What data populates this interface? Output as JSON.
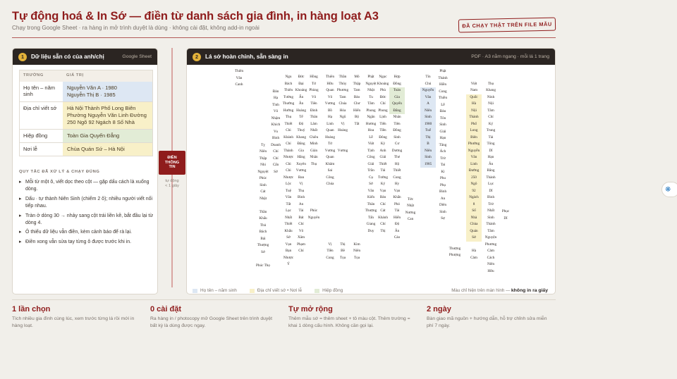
{
  "header": {
    "title": "Tự động hoá & In Sớ — điền từ danh sách gia đình, in hàng loạt A3",
    "subtitle": "Chạy trong Google Sheet · ra hàng in mở trình duyệt là dùng · không cài đặt, không add-in ngoài",
    "stamp": "ĐÃ CHẠY THẬT TRÊN FILE MẪU"
  },
  "left_panel": {
    "num": "1",
    "title": "Dữ liệu sẵn có của anh/chị",
    "tag": "Google Sheet",
    "table": {
      "headers": [
        "TRƯỜNG",
        "GIÁ TRỊ"
      ],
      "rows": [
        {
          "field": "Họ tên – năm sinh",
          "value": "Nguyễn Văn A · 1980\nNguyễn Thị B · 1985",
          "color": "#dde7f3"
        },
        {
          "field": "Địa chỉ viết sớ",
          "value": "Hà Nội Thành Phố Long Biên Phường Nguyễn Văn Linh Đường 250 Ngõ 92 Ngách 8 Số Nhà",
          "color": "#f8f0c8"
        },
        {
          "field": "Hiệp đồng",
          "value": "Toàn Gia Quyến Đẳng",
          "color": "#e2ecd6"
        },
        {
          "field": "Nơi lễ",
          "value": "Chùa Quán Sứ – Hà Nội",
          "color": "#f8f0c8"
        }
      ]
    },
    "rules_title": "QUY TẮC ĐÃ XỬ LÝ & CHẠY ĐÚNG",
    "rules": [
      "Mỗi từ một ô, viết dọc theo cột — gặp dấu cách là xuống dòng.",
      "Dấu · tự thành Niên Sinh (chiếm 2 ô); nhiều người viết nối tiếp nhau.",
      "Tràn ở dòng 30 → nhảy sang cột trái liền kề, bắt đầu lại từ dòng 4.",
      "Ô thiếu dữ liệu vẫn điền, kèm cảnh báo để rà lại.",
      "Điền xong vẫn sửa tay từng ô được trước khi in."
    ]
  },
  "middle": {
    "label": "ĐIỀN\nTHÔNG\nTIN",
    "note": "tự động\n< 1 giây"
  },
  "right_panel": {
    "num": "2",
    "title": "Lá sớ hoàn chỉnh, sẵn sàng in",
    "tag": "PDF · A3 nằm ngang · mỗi lá 1 trang",
    "columns": [
      [
        "Thiên",
        "Văn",
        "Canh"
      ],
      [
        "",
        "",
        "",
        "",
        "",
        "",
        "",
        "",
        "",
        "",
        "",
        "Tỵ",
        "Niên",
        "Thập",
        "Nhi",
        "Nguyệt",
        "Phúc",
        "Sinh",
        "Cát",
        "Nhật",
        "",
        "Thần",
        "Khấu",
        "Thủ",
        "Bách",
        "Bái",
        "Thượng",
        "Sớ",
        "",
        "Phúc Thọ"
      ],
      [
        "",
        "",
        "",
        "Đàn",
        "Hạ",
        "Tình",
        "Vô",
        "Nhậm",
        "Khích",
        "Vu",
        "Bình",
        "Doanh",
        "Chí",
        "Chí",
        "Cẩn",
        "Sớ"
      ],
      [
        "Ngu",
        "Bách",
        "Thiên",
        "Tường",
        "Thường",
        "Hưởng",
        "Thụ",
        "Thiết",
        "Chi",
        "Khánh",
        "Chí",
        "Thành",
        "Nhược",
        "Chi",
        "Chi",
        "Nhược",
        "Lộc",
        "Tuệ",
        "Văn",
        "Tất",
        "Lạc",
        "Nhất",
        "Thiết",
        "Khẩu",
        "Sớ",
        "Vạn",
        "Bạn",
        "Nhược",
        "Ý"
      ],
      [
        "Đức",
        "Đại",
        "Khoáng",
        "Ẩn",
        "Ân",
        "Hoàng",
        "Tế",
        "Độ",
        "Thuỷ",
        "Khang",
        "Đăng",
        "Gia",
        "Hằng",
        "Xuyên",
        "Vương",
        "Ban",
        "Vị",
        "Thụ",
        "Bình",
        "An",
        "Tài",
        "Bát",
        "Chí",
        "Vô",
        "Xâm",
        "Phạm",
        "Chí"
      ],
      [
        "Hồng",
        "Tứ",
        "Phùng",
        "Vô",
        "Tiên",
        "Đình",
        "Thân",
        "Lâm",
        "Nhất",
        "Chiêu",
        "Minh",
        "Gián",
        "Nhân",
        "Thụ",
        "",
        "",
        "",
        "",
        "",
        "",
        "Phúc",
        "Nguyên"
      ],
      [
        "Thiên",
        "Hữu",
        "Quan",
        "Vô",
        "Vương",
        "Bồ",
        "Hạ",
        "Linh",
        "Quan",
        "Hoàng",
        "Tứ",
        "Vương",
        "Quan",
        "Khâm",
        "Sai",
        "Công",
        "Chúa",
        "",
        "",
        "",
        "",
        "",
        "",
        "",
        "",
        "Vị",
        "Tiền",
        "Cung"
      ],
      [
        "Thần",
        "Thủy",
        "Phương",
        "Tam",
        "Chúa",
        "Hóa",
        "Ngũ",
        "Vị",
        "Hoàng",
        "",
        "",
        "Vương",
        "",
        "",
        "",
        "",
        "",
        "",
        "",
        "",
        "",
        "",
        "",
        "",
        "",
        "Thị",
        "Bề",
        "Tọa"
      ],
      [
        "Mô",
        "Thập",
        "Tam",
        "Bảo",
        "Chư",
        "Hiển",
        "Bộ",
        "Tất",
        "",
        "",
        "",
        "",
        "",
        "",
        "",
        "",
        "",
        "",
        "",
        "",
        "",
        "",
        "",
        "",
        "",
        "Kim",
        "Niên",
        "Tọa"
      ],
      [
        "Phật",
        "Nguyệt",
        "Nhật",
        "Tu",
        "Tâm",
        "Phong",
        "Ngân",
        "Hương",
        "Hoa",
        "Lễ",
        "Việt",
        "Tịnh",
        "Công",
        "Giải",
        "Trần",
        "Cụ",
        "Sở",
        "Văn",
        "Kiến",
        "Thân",
        "Thượng",
        "Tấn",
        "Giang",
        "Duy"
      ],
      [
        "Ngọc",
        "Khoáng",
        "Phù",
        "Đức",
        "Chí",
        "Phong",
        "Lịnh",
        "Tiến",
        "Tiền",
        "Đông",
        "Kỳ",
        "Anh",
        "Giải",
        "Thiết",
        "Tải",
        "Tường",
        "Kỷ",
        "Vạn",
        "Bản",
        "Chí",
        "Cát",
        "Khánh",
        "Chí",
        "Thị"
      ],
      [
        "Hợp",
        "Đồng",
        "Toàn",
        "Gia",
        "Quyến",
        "Đẳng",
        "Nhân",
        "Tiên",
        "Đồng",
        "Sinh",
        "Cư",
        "Dương",
        "Thé",
        "Hộ",
        "Thiết",
        "Cung",
        "Hy",
        "Vạn",
        "Khẩn",
        "Phó",
        "Tài",
        "Hiển",
        "Độ",
        "Ân",
        "Cáo"
      ],
      [
        "",
        "",
        "",
        "",
        "",
        "",
        "",
        "",
        "",
        "Tức",
        "Nhật",
        "Nương",
        "Can"
      ],
      [
        "Tín",
        "Chủ",
        "Nguyễn",
        "Văn",
        "A",
        "Niên",
        "Sinh",
        "1980",
        "Tuế",
        "Thị",
        "B",
        "Niên",
        "Sinh",
        "1985"
      ],
      [
        "Phật",
        "Thánh",
        "Hiền",
        "Cung",
        "Thiền",
        "Lễ",
        "Đàu",
        "Tôn",
        "Sinh",
        "Giải",
        "Hạn",
        "Tăng",
        "Ách",
        "Trừ",
        "Tai",
        "Kì",
        "Phu",
        "Phụ",
        "Bình",
        "An",
        "Diên",
        "Sinh",
        "Sự"
      ],
      [
        "",
        "",
        "",
        "",
        "",
        "",
        "",
        "",
        "",
        "",
        "",
        "",
        "",
        "Thượng",
        "Phượng"
      ],
      [
        "",
        "Việt",
        "Nam",
        "Quốc",
        "Hà",
        "Nội",
        "Thành",
        "Phố",
        "Long",
        "Biên",
        "Phường",
        "Nguyễn",
        "Văn",
        "Linh",
        "Đường",
        "250",
        "Ngõ",
        "92",
        "Ngách",
        "8",
        "Số",
        "Nhà",
        "Chùa",
        "Quán",
        "Sứ",
        "",
        "Hà",
        "Cảm"
      ],
      [
        "",
        "Thọ",
        "Khang",
        "Ninh",
        "Nội",
        "Tâm",
        "Chí",
        "Ký",
        "Trung",
        "Tài",
        "Tông",
        "Dĩ",
        "Hạn",
        "Ân",
        "Bằng",
        "Thành",
        "Lục",
        "Dĩ",
        "Bình",
        "Trừ",
        "Nhất",
        "Sinh",
        "Thành",
        "Tâm",
        "Nguyện",
        "Phương",
        "Cảm",
        "Cách",
        "Niên",
        "Hữu"
      ],
      [
        "",
        "",
        "",
        "",
        "",
        "",
        "",
        "",
        "",
        "",
        "Phục",
        "Dĩ"
      ]
    ],
    "legend": [
      {
        "label": "Họ tên – năm sinh",
        "color": "#dde7f3"
      },
      {
        "label": "Địa chỉ viết sớ • Nơi lễ",
        "color": "#f8f0c8"
      },
      {
        "label": "Hiệp đồng",
        "color": "#e2ecd6"
      }
    ],
    "legend_note": "Màu chỉ hiện trên màn hình —",
    "legend_note_bold": "không in ra giấy"
  },
  "features": [
    {
      "title": "1 lần chọn",
      "desc": "Tích nhiều gia đình cùng lúc, xem trước từng lá rồi mới in hàng loạt."
    },
    {
      "title": "0 cài đặt",
      "desc": "Ra hàng in / photocopy mở Google Sheet trên trình duyệt bất kỳ là dùng được ngay."
    },
    {
      "title": "Tự mở rộng",
      "desc": "Thêm mẫu sớ = thêm sheet + tô màu cột. Thêm trường = khai 1 dòng cấu hình. Không cần gọi lại."
    },
    {
      "title": "2 ngày",
      "desc": "Bàn giao mã nguồn + hướng dẫn, hỗ trợ chỉnh sửa miễn phí 7 ngày."
    }
  ]
}
